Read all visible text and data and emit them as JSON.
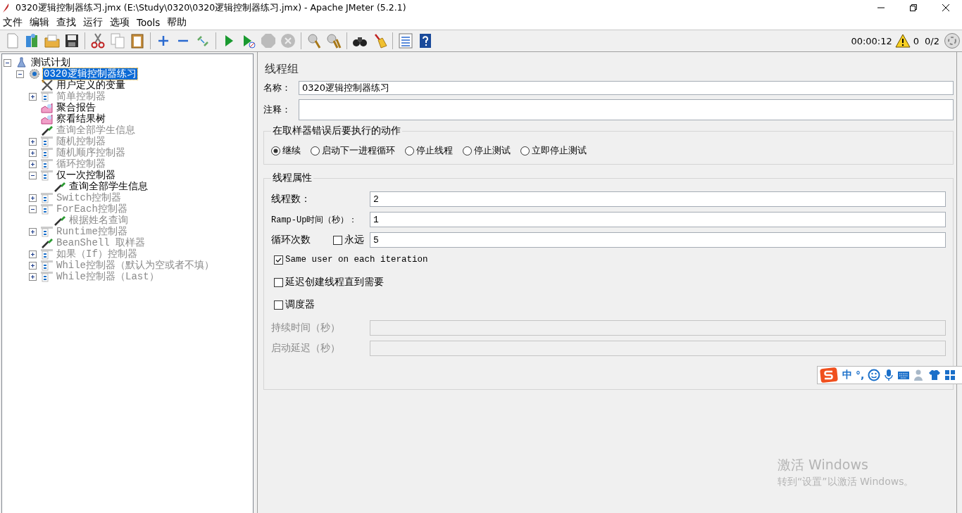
{
  "window": {
    "title": "0320逻辑控制器练习.jmx (E:\\Study\\0320\\0320逻辑控制器练习.jmx) - Apache JMeter (5.2.1)"
  },
  "menu": [
    "文件",
    "编辑",
    "查找",
    "运行",
    "选项",
    "Tools",
    "帮助"
  ],
  "status": {
    "timer": "00:00:12",
    "warnings": "0",
    "threads": "0/2"
  },
  "tree": [
    {
      "kind": "plan",
      "label": "测试计划",
      "expanded": true,
      "selected": false,
      "disabled": false,
      "children": [
        {
          "kind": "thread_group",
          "label": "0320逻辑控制器练习",
          "expanded": true,
          "selected": true,
          "disabled": false,
          "children": [
            {
              "kind": "config",
              "label": "用户定义的变量",
              "selected": false,
              "disabled": false
            },
            {
              "kind": "controller",
              "label": "简单控制器",
              "expanded": false,
              "selected": false,
              "disabled": true
            },
            {
              "kind": "listener",
              "label": "聚合报告",
              "selected": false,
              "disabled": false
            },
            {
              "kind": "listener",
              "label": "察看结果树",
              "selected": false,
              "disabled": false
            },
            {
              "kind": "sampler",
              "label": "查询全部学生信息",
              "selected": false,
              "disabled": true
            },
            {
              "kind": "controller",
              "label": "随机控制器",
              "expanded": false,
              "selected": false,
              "disabled": true
            },
            {
              "kind": "controller",
              "label": "随机顺序控制器",
              "expanded": false,
              "selected": false,
              "disabled": true
            },
            {
              "kind": "controller",
              "label": "循环控制器",
              "expanded": false,
              "selected": false,
              "disabled": true
            },
            {
              "kind": "controller",
              "label": "仅一次控制器",
              "expanded": true,
              "selected": false,
              "disabled": false,
              "children": [
                {
                  "kind": "sampler",
                  "label": "查询全部学生信息",
                  "selected": false,
                  "disabled": false
                }
              ]
            },
            {
              "kind": "controller",
              "label": "Switch控制器",
              "expanded": false,
              "selected": false,
              "disabled": true
            },
            {
              "kind": "controller",
              "label": "ForEach控制器",
              "expanded": true,
              "selected": false,
              "disabled": true,
              "children": [
                {
                  "kind": "sampler",
                  "label": "根据姓名查询",
                  "selected": false,
                  "disabled": true
                }
              ]
            },
            {
              "kind": "controller",
              "label": "Runtime控制器",
              "expanded": false,
              "selected": false,
              "disabled": true
            },
            {
              "kind": "sampler",
              "label": "BeanShell 取样器",
              "selected": false,
              "disabled": true
            },
            {
              "kind": "controller",
              "label": "如果（If）控制器",
              "expanded": false,
              "selected": false,
              "disabled": true
            },
            {
              "kind": "controller",
              "label": "While控制器（默认为空或者不填）",
              "expanded": false,
              "selected": false,
              "disabled": true
            },
            {
              "kind": "controller",
              "label": "While控制器（Last）",
              "expanded": false,
              "selected": false,
              "disabled": true
            }
          ]
        }
      ]
    }
  ],
  "panel": {
    "title": "线程组",
    "name_label": "名称：",
    "name_value": "0320逻辑控制器练习",
    "comment_label": "注释：",
    "error_action": {
      "legend": "在取样器错误后要执行的动作",
      "options": [
        {
          "label": "继续",
          "selected": true
        },
        {
          "label": "启动下一进程循环",
          "selected": false
        },
        {
          "label": "停止线程",
          "selected": false
        },
        {
          "label": "停止测试",
          "selected": false
        },
        {
          "label": "立即停止测试",
          "selected": false
        }
      ]
    },
    "thread_props": {
      "legend": "线程属性",
      "rows": [
        {
          "kind": "field",
          "label": "线程数：",
          "value": "2",
          "disabled": false
        },
        {
          "kind": "field",
          "label": "Ramp-Up时间（秒）：",
          "value": "1",
          "disabled": false
        },
        {
          "kind": "loop",
          "label": "循环次数",
          "forever_label": "永远",
          "forever_checked": false,
          "value": "5",
          "disabled": false
        },
        {
          "kind": "check",
          "label": "Same user on each iteration",
          "checked": true
        },
        {
          "kind": "check",
          "label": "延迟创建线程直到需要",
          "checked": false
        },
        {
          "kind": "check",
          "label": "调度器",
          "checked": false
        },
        {
          "kind": "field",
          "label": "持续时间（秒）",
          "value": "",
          "disabled": true
        },
        {
          "kind": "field",
          "label": "启动延迟（秒）",
          "value": "",
          "disabled": true
        }
      ]
    }
  },
  "ime": {
    "mode": "中",
    "punctuation": "°,"
  },
  "activation": {
    "title": "激活 Windows",
    "hint": "转到“设置”以激活 Windows。"
  }
}
